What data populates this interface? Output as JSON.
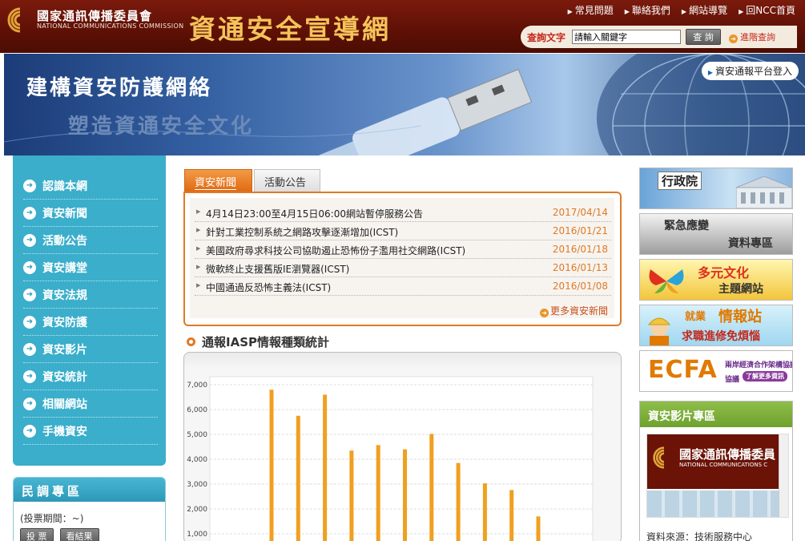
{
  "header": {
    "org_name_zh": "國家通訊傳播委員會",
    "org_name_en": "NATIONAL COMMUNICATIONS COMMISSION",
    "site_title": "資通安全宣導網",
    "top_links": [
      "常見問題",
      "聯絡我們",
      "網站導覽",
      "回NCC首頁"
    ],
    "search": {
      "label": "查詢文字",
      "value": "請輸入關鍵字",
      "button_label": "查 詢",
      "advanced_label": "進階查詢"
    },
    "colors": {
      "header_bg": "#5e1005",
      "title_gold": "#f4c35a"
    }
  },
  "banner": {
    "headline": "建構資安防護網絡",
    "subline": "塑造資通安全文化",
    "report_login": "資安通報平台登入"
  },
  "left_nav": {
    "items": [
      "認識本網",
      "資安新聞",
      "活動公告",
      "資安講堂",
      "資安法規",
      "資安防護",
      "資安影片",
      "資安統計",
      "相關網站",
      "手機資安"
    ],
    "accent": "#3aaecb"
  },
  "poll": {
    "title": "民調專區",
    "period": "(投票期間：~)",
    "vote_label": "投 票",
    "results_label": "看結果"
  },
  "news": {
    "tabs": [
      "資安新聞",
      "活動公告"
    ],
    "items": [
      {
        "title": "4月14日23:00至4月15日06:00網站暫停服務公告",
        "date": "2017/04/14"
      },
      {
        "title": "針對工業控制系統之網路攻擊逐漸增加(ICST)",
        "date": "2016/01/21"
      },
      {
        "title": "美國政府尋求科技公司協助遏止恐怖份子濫用社交網路(ICST)",
        "date": "2016/01/18"
      },
      {
        "title": "微軟終止支援舊版IE瀏覽器(ICST)",
        "date": "2016/01/13"
      },
      {
        "title": "中國通過反恐怖主義法(ICST)",
        "date": "2016/01/08"
      }
    ],
    "more_label": "更多資安新聞",
    "accent": "#e07a26"
  },
  "chart_heading": "通報IASP情報種類統計",
  "chart_data": {
    "type": "bar",
    "values": [
      6800,
      5750,
      6600,
      4350,
      4570,
      4400,
      5020,
      3850,
      3030,
      2760,
      1700
    ],
    "ylim": [
      0,
      7000
    ],
    "yticks": [
      "1,000",
      "2,000",
      "3,000",
      "4,000",
      "5,000",
      "6,000",
      "7,000"
    ],
    "grid": true,
    "bar_color": "#f0a020"
  },
  "right_column": {
    "promos": {
      "exec": "行政院",
      "emer_1": "緊急應變",
      "emer_2": "資料專區",
      "multi_1": "多元文化",
      "multi_2": "主題網站",
      "job_1": "就業",
      "job_2": "情報站",
      "job_3": "求職進修免煩惱",
      "ecfa_1": "ECFA",
      "ecfa_2": "兩岸經濟合作架構協議",
      "ecfa_3": "協議",
      "ecfa_4": "了解更多資訊"
    },
    "video": {
      "title": "資安影片專區",
      "thumb_zh": "國家通訊傳播委員",
      "thumb_en": "NATIONAL COMMUNICATIONS C",
      "source": "資料來源：技術服務中心"
    }
  }
}
